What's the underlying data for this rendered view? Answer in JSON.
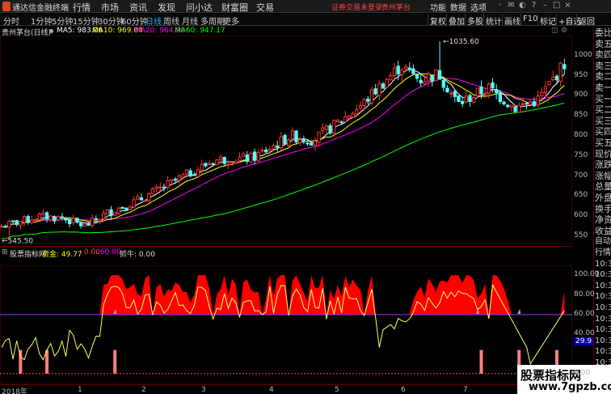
{
  "app": {
    "title": "通达信金融终端",
    "menu": [
      "行情",
      "市场",
      "资讯",
      "发现",
      "问小达",
      "财富圈",
      "交易"
    ],
    "status": "证券交易未登录",
    "stock_short": "贵州茅台",
    "right_menu": [
      "功能",
      "数据",
      "选项"
    ],
    "user": "游客"
  },
  "toolbar": {
    "periods": [
      "分时",
      "1分钟",
      "5分钟",
      "15分钟",
      "30分钟",
      "60分钟",
      "日线",
      "周线",
      "月线",
      "多周期",
      "更多"
    ],
    "active_period": "日线",
    "buttons": [
      "复权",
      "叠加",
      "多股",
      "统计",
      "画线",
      "F10",
      "标记",
      "+自选",
      "返回"
    ]
  },
  "info": {
    "stock": "贵州茅台(日线)",
    "ma5_label": "MA5: 983.06",
    "ma10_label": "MA10: 969.04",
    "ma20_label": "MA20: 964.90",
    "ma60_label": "MA60: 947.17"
  },
  "colors": {
    "up": "#ff3232",
    "down": "#54ffff",
    "ma5": "#ffffff",
    "ma10": "#ffff00",
    "ma20": "#ff00ff",
    "ma60": "#00ff00",
    "fund_fill": "#ff0000",
    "fund_line": "#ffff66",
    "threshold": "#9933ff"
  },
  "price_axis": {
    "ticks": [
      "1000",
      "950",
      "900",
      "850",
      "800",
      "750",
      "700",
      "650",
      "600",
      "550"
    ],
    "high_label": "1035.60",
    "low_label": "545.50"
  },
  "right_panel": [
    "委比",
    "卖五",
    "卖四",
    "卖三",
    "卖二",
    "卖一",
    "买一",
    "买二",
    "买三",
    "买四",
    "买五",
    "现价",
    "涨跌",
    "涨幅",
    "总量",
    "外盘",
    "换手",
    "净资",
    "收益",
    "自动",
    "行情",
    "10:31",
    "10:31",
    "10:31",
    "10:31",
    "10:31",
    "10:31",
    "10:31",
    "10:32",
    "10:32",
    "10:32",
    "10:32"
  ],
  "indicator": {
    "name": "股票指标网",
    "fund_label": "资金: 49.77",
    "v1": ": 0.00",
    "v2": ": 60.00",
    "v3": "抓牛: 0.00",
    "axis": [
      "100.00",
      "80.00",
      "60.00",
      "40.00",
      "29.9",
      "0.00"
    ]
  },
  "xaxis": [
    "2018年",
    "1",
    "2",
    "3",
    "4",
    "5",
    "6",
    "7"
  ],
  "watermark": {
    "line1": "股票指标网",
    "line2": "www.7gpzb.com"
  },
  "chart_data": {
    "type": "candlestick",
    "title": "贵州茅台(日线)",
    "ylim": [
      530,
      1050
    ],
    "high": 1035.6,
    "low": 545.5,
    "ma_last": {
      "MA5": 983.06,
      "MA10": 969.04,
      "MA20": 964.9,
      "MA60": 947.17
    }
  }
}
